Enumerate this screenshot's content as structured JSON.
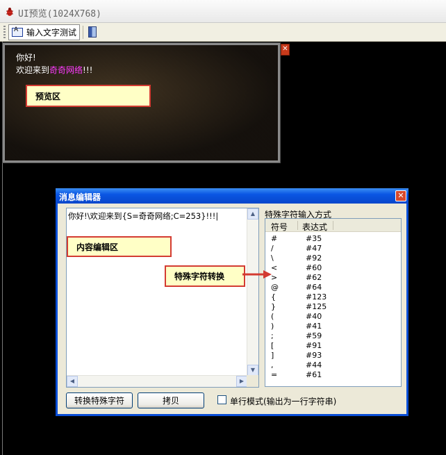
{
  "window": {
    "title": "UI预览(1024X768)"
  },
  "toolbar": {
    "input_text_test": "输入文字测试"
  },
  "preview": {
    "line1": "你好!",
    "line2_prefix": "欢迎来到",
    "line2_highlight": "奇奇网络",
    "line2_suffix": "!!!",
    "highlight_color": "#ff3cff"
  },
  "callouts": {
    "preview_area": "预览区",
    "content_edit_area": "内容编辑区",
    "special_char_convert": "特殊字符转换"
  },
  "dialog": {
    "title": "消息编辑器",
    "editor_content": "你好!\\欢迎来到{S=奇奇网络;C=253}!!!|",
    "special_label": "特殊字符输入方式",
    "col_symbol": "符号",
    "col_expression": "表达式",
    "rows": [
      {
        "symbol": "#",
        "expr": "#35"
      },
      {
        "symbol": "/",
        "expr": "#47"
      },
      {
        "symbol": "\\",
        "expr": "#92"
      },
      {
        "symbol": "<",
        "expr": "#60"
      },
      {
        "symbol": ">",
        "expr": "#62"
      },
      {
        "symbol": "@",
        "expr": "#64"
      },
      {
        "symbol": "{",
        "expr": "#123"
      },
      {
        "symbol": "}",
        "expr": "#125"
      },
      {
        "symbol": "(",
        "expr": "#40"
      },
      {
        "symbol": ")",
        "expr": "#41"
      },
      {
        "symbol": ";",
        "expr": "#59"
      },
      {
        "symbol": "[",
        "expr": "#91"
      },
      {
        "symbol": "]",
        "expr": "#93"
      },
      {
        "symbol": ",",
        "expr": "#44"
      },
      {
        "symbol": "=",
        "expr": "#61"
      }
    ],
    "convert_button": "转换特殊字符",
    "copy_button": "拷贝",
    "single_line_label": "单行模式(输出为一行字符串)",
    "single_line_checked": false
  },
  "colors": {
    "dialog_title_blue": "#0a56e3",
    "callout_border": "#d33b32",
    "callout_fill": "#ffffc6"
  }
}
